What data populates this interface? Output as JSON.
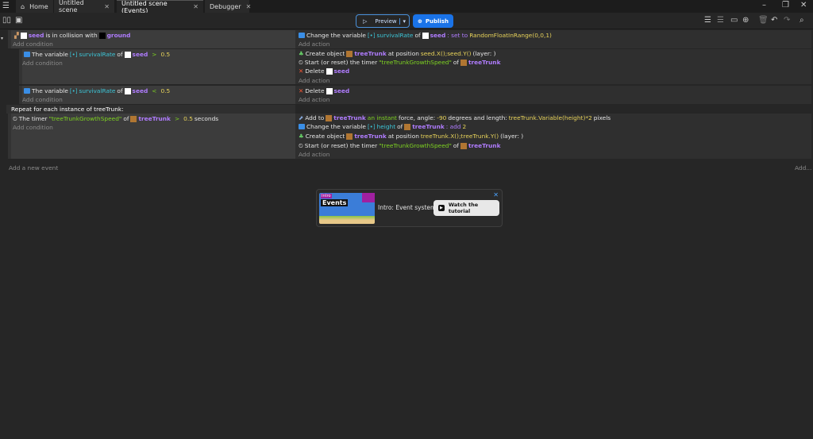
{
  "tabs": [
    {
      "label": "Home"
    },
    {
      "label": "Untitled scene"
    },
    {
      "label": "Untitled scene (Events)"
    },
    {
      "label": "Debugger"
    }
  ],
  "toolbar": {
    "preview": "Preview",
    "publish": "Publish"
  },
  "events": {
    "e1": {
      "c1_obj": "seed",
      "c1_text": "is in collision with",
      "c1_obj2": "ground",
      "a1_pre": "Change the variable",
      "a1_var": "survivalRate",
      "a1_of": "of",
      "a1_obj": "seed",
      "a1_op": ": set to",
      "a1_val": "RandomFloatInRange(0,0,1)"
    },
    "s1": {
      "pre": "The variable",
      "var": "survivalRate",
      "of": "of",
      "obj": "seed",
      "op": ">",
      "val": "0.5",
      "a1_pre": "Create object",
      "a1_obj": "treeTrunk",
      "a1_mid": "at position",
      "a1_pos": "seed.X();seed.Y()",
      "a1_layer": "(layer: )",
      "a2_pre": "Start (or reset) the timer",
      "a2_str": "\"treeTrunkGrowthSpeed\"",
      "a2_of": "of",
      "a2_obj": "treeTrunk",
      "a3_pre": "Delete",
      "a3_obj": "seed"
    },
    "s2": {
      "pre": "The variable",
      "var": "survivalRate",
      "of": "of",
      "obj": "seed",
      "op": "<",
      "val": "0.5",
      "a1_pre": "Delete",
      "a1_obj": "seed"
    },
    "r": {
      "header": "Repeat for each instance of treeTrunk:",
      "c_pre": "The timer",
      "c_str": "\"treeTrunkGrowthSpeed\"",
      "c_of": "of",
      "c_obj": "treeTrunk",
      "c_op": ">",
      "c_val": "0.5",
      "c_unit": "seconds",
      "a1_pre": "Add to",
      "a1_obj": "treeTrunk",
      "a1_kind": "an instant",
      "a1_mid": "force, angle:",
      "a1_angle": "-90",
      "a1_mid2": "degrees and length:",
      "a1_len": "treeTrunk.Variable(height)*2",
      "a1_unit": "pixels",
      "a2_pre": "Change the variable",
      "a2_var": "height",
      "a2_of": "of",
      "a2_obj": "treeTrunk",
      "a2_op": ": add",
      "a2_val": "2",
      "a3_pre": "Create object",
      "a3_obj": "treeTrunk",
      "a3_mid": "at position",
      "a3_pos": "treeTrunk.X();treeTrunk.Y()",
      "a3_layer": "(layer: )",
      "a4_pre": "Start (or reset) the timer",
      "a4_str": "\"treeTrunkGrowthSpeed\"",
      "a4_of": "of",
      "a4_obj": "treeTrunk"
    }
  },
  "labels": {
    "add_condition": "Add condition",
    "add_action": "Add action",
    "add_event": "Add a new event",
    "add_more": "Add..."
  },
  "tutorial": {
    "thumb_tag": "Intro",
    "thumb_title": "Events",
    "title": "Intro: Event system",
    "button": "Watch the tutorial"
  }
}
